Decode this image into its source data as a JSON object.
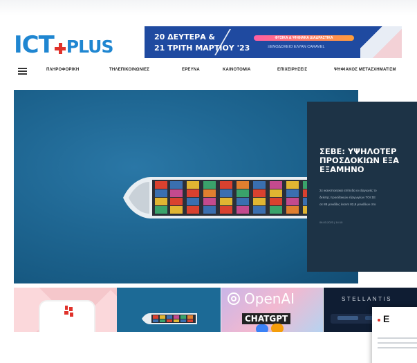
{
  "brand": {
    "logo_ict": "ICT",
    "logo_plus": "PLUS",
    "accent": "#1f86d1",
    "plus_color": "#e0322b"
  },
  "banner": {
    "line1": "20 ΔΕΥΤΕΡΑ &",
    "line2": "21 ΤΡΙΤΗ ΜΑΡΤΙΟΥ '23",
    "pill": "ΦΥΣΙΚΑ & ΨΗΦΙΑΚΑ ΔΙΑΔΡΑΣΤΙΚΑ",
    "venue": "ΞΕΝΟΔΟΧΕΙΟ ΕΛΥΑΝ CARAVEL"
  },
  "nav": {
    "menu_icon": "hamburger-icon",
    "items": [
      "ΠΛΗΡΟΦΟΡΙΚΗ",
      "ΤΗΛΕΠΙΚΟΙΝΩΝΙΕΣ",
      "ΕΡΕΥΝΑ",
      "ΚΑΙΝΟΤΟΜΙΑ",
      "ΕΠΙΧΕΙΡΗΣΕΙΣ",
      "ΨΗΦΙΑΚΟΣ ΜΕΤΑΣΧΗΜΑΤΙΣΜ"
    ]
  },
  "hero": {
    "title": "ΣΕΒΕ: ΥΨΗΛΟΤΕΡ ΠΡΟΣΔΟΚΙΩΝ ΕΞΑ ΕΞΑΜΗΝΟ",
    "excerpt_lines": [
      "Σε ικανοποιητικά επίπεδα οι εξαγωγές το",
      "δείκτης προσδοκιών εξαγωγέων ΤΟΙ ΣΕ",
      "σε 88 μονάδες έναντι 82,8 μονάδων στο"
    ],
    "date": "06.03.2023 | 14:10"
  },
  "thumbnails": [
    {
      "label": "equinor"
    },
    {
      "label": ""
    },
    {
      "label": "OpenAI",
      "badge": "CHAT",
      "badge_suffix": "GPT"
    },
    {
      "label": "STELLANTIS"
    }
  ],
  "popcard": {
    "letter": "Ε"
  }
}
